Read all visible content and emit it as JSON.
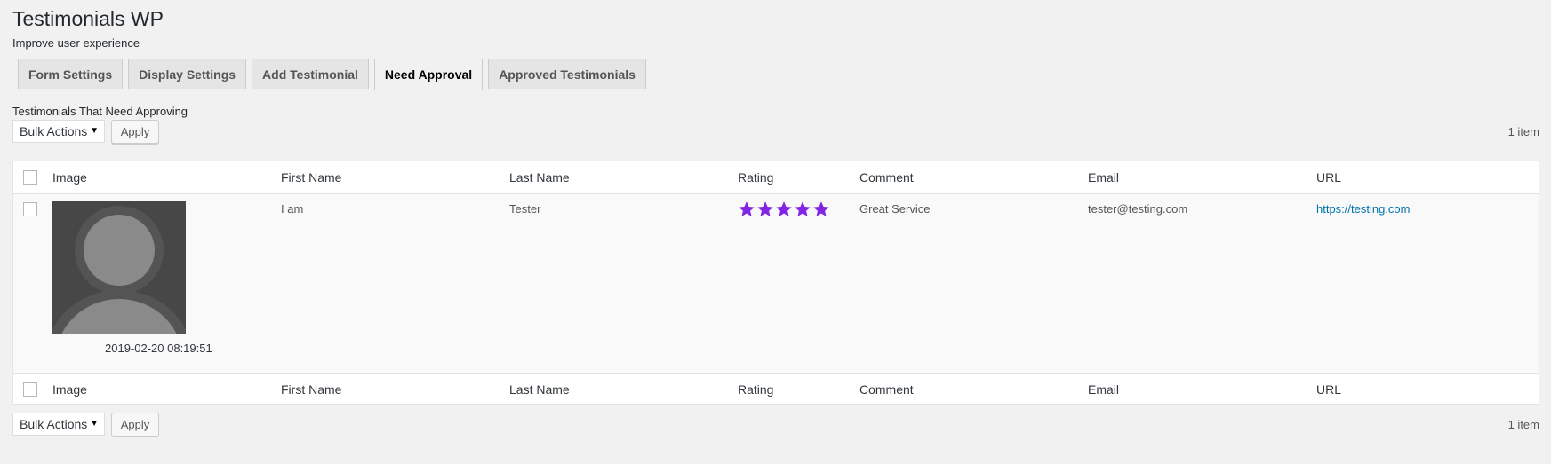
{
  "header": {
    "title": "Testimonials WP",
    "subtitle": "Improve user experience"
  },
  "tabs": [
    {
      "label": "Form Settings",
      "active": false
    },
    {
      "label": "Display Settings",
      "active": false
    },
    {
      "label": "Add Testimonial",
      "active": false
    },
    {
      "label": "Need Approval",
      "active": true
    },
    {
      "label": "Approved Testimonials",
      "active": false
    }
  ],
  "section_label": "Testimonials That Need Approving",
  "tablenav": {
    "bulk_actions_label": "Bulk Actions",
    "apply_label": "Apply",
    "item_count": "1 item"
  },
  "columns": {
    "image": "Image",
    "first_name": "First Name",
    "last_name": "Last Name",
    "rating": "Rating",
    "comment": "Comment",
    "email": "Email",
    "url": "URL"
  },
  "rows": [
    {
      "image": "default-avatar",
      "date": "2019-02-20 08:19:51",
      "first_name": "I am",
      "last_name": "Tester",
      "rating": 5,
      "rating_max": 5,
      "comment": "Great Service",
      "email": "tester@testing.com",
      "url": "https://testing.com"
    }
  ],
  "colors": {
    "star": "#8224e3",
    "link": "#0073aa"
  }
}
